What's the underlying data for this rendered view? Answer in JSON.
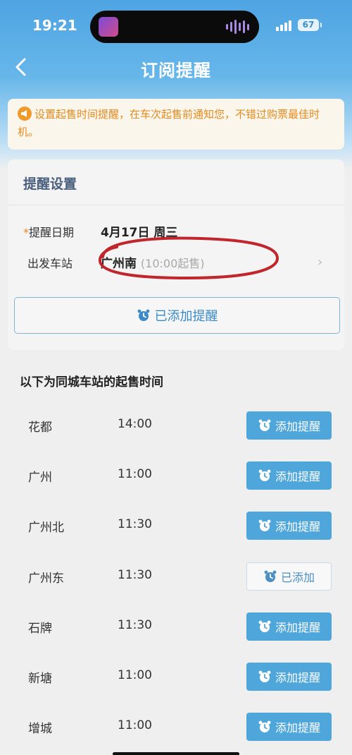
{
  "status_bar": {
    "time": "19:21",
    "battery": "67"
  },
  "nav": {
    "title": "订阅提醒"
  },
  "notice": {
    "text": "设置起售时间提醒，在车次起售前通知您，不错过购票最佳时机。"
  },
  "settings": {
    "title": "提醒设置",
    "date_label_star": "*",
    "date_label": "提醒日期",
    "date_value": "4月17日 周三",
    "station_label": "出发车站",
    "station_value": "广州南",
    "sale_time": "(10:00起售)",
    "added_button_label": "已添加提醒"
  },
  "same_city": {
    "heading": "以下为同城车站的起售时间",
    "stations": [
      {
        "name": "花都",
        "time": "14:00",
        "button": "添加提醒",
        "added": false
      },
      {
        "name": "广州",
        "time": "11:00",
        "button": "添加提醒",
        "added": false
      },
      {
        "name": "广州北",
        "time": "11:30",
        "button": "添加提醒",
        "added": false
      },
      {
        "name": "广州东",
        "time": "11:30",
        "button": "已添加",
        "added": true
      },
      {
        "name": "石牌",
        "time": "11:30",
        "button": "添加提醒",
        "added": false
      },
      {
        "name": "新塘",
        "time": "11:00",
        "button": "添加提醒",
        "added": false
      },
      {
        "name": "增城",
        "time": "11:00",
        "button": "添加提醒",
        "added": false
      }
    ]
  },
  "colors": {
    "accent": "#4fa6db",
    "notice": "#e58a1f",
    "annotation": "#c0262b"
  },
  "icons": {
    "back": "chevron-left-icon",
    "notice": "megaphone-icon",
    "alarm": "alarm-clock-icon",
    "chevron": "chevron-right-icon"
  }
}
